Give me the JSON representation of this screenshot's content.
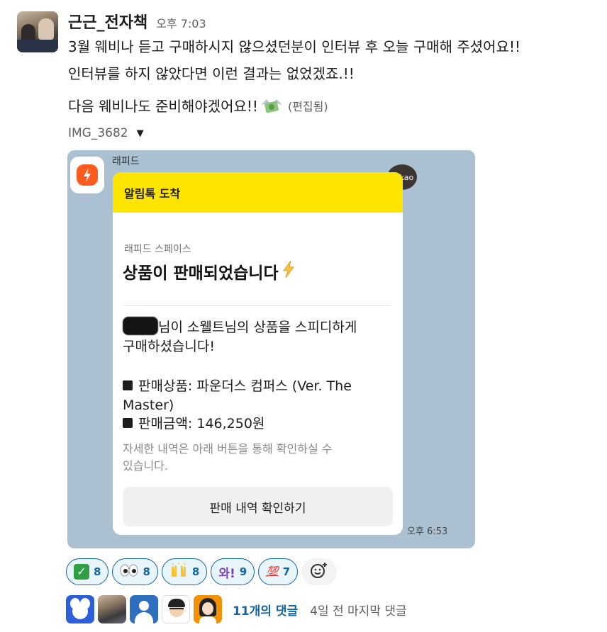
{
  "message": {
    "author": "근근_전자책",
    "timestamp": "오후 7:03",
    "lines": [
      "3월 웨비나 듣고 구매하시지 않으셨던분이 인터뷰 후 오늘 구매해 주셨어요!!",
      "인터뷰를 하지 않았다면 이런 결과는 없었겠죠.!!",
      "다음 웨비나도 준비해야겠어요!!"
    ],
    "inline_emoji": "money-with-wings",
    "edited_label": "(편집됨)"
  },
  "attachment": {
    "filename": "IMG_3682",
    "screenshot": {
      "sender": "래피드",
      "badge": "kakao",
      "card_header": "알림톡 도착",
      "card_sub": "래피드 스페이스",
      "card_title": "상품이 판매되었습니다",
      "body_line1": "님이 소웰트님의 상품을 스피디하게",
      "body_line2": "구매하셨습니다!",
      "product_label": "판매상품: 파운더스 컴퍼스 (Ver. The",
      "product_label_cont": "Master)",
      "amount_label": "판매금액: 146,250원",
      "note_line1": "자세한 내역은 아래 버튼을 통해 확인하실 수",
      "note_line2": "있습니다.",
      "button_label": "판매 내역 확인하기",
      "time": "오후 6:53"
    }
  },
  "reactions": [
    {
      "icon": "check-mark",
      "count": "8"
    },
    {
      "icon": "eyes",
      "count": "8"
    },
    {
      "icon": "raised-hands",
      "count": "8"
    },
    {
      "icon": "wa-text",
      "label": "와!",
      "count": "9"
    },
    {
      "icon": "hundred-points",
      "label": "💯",
      "count": "7"
    }
  ],
  "thread": {
    "reply_count": "11개의 댓글",
    "last_reply": "4일 전 마지막 댓글"
  },
  "colors": {
    "link": "#1264a3",
    "kakao_yellow": "#fee500",
    "chat_bg": "#abc1d1",
    "rapid_orange": "#ff5a1f"
  }
}
